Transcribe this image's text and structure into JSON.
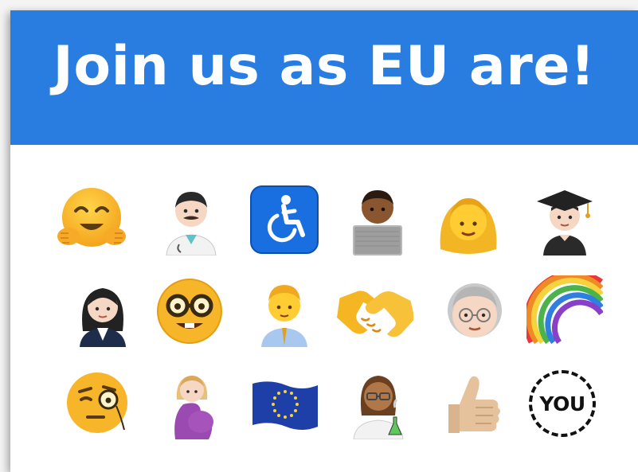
{
  "banner": {
    "title": "Join us as EU are!",
    "background": "#2a7de0",
    "text_color": "#ffffff"
  },
  "emoji_grid": {
    "rows": [
      [
        "hugging-face",
        "male-health-worker",
        "wheelchair-symbol",
        "man-technologist",
        "blond-woman",
        "male-graduate"
      ],
      [
        "woman-office-worker",
        "nerd-face",
        "man-office-worker",
        "handshake",
        "older-person",
        "rainbow"
      ],
      [
        "face-with-monocle",
        "pregnant-woman",
        "eu-flag",
        "woman-scientist",
        "thumbs-up",
        "you-badge"
      ]
    ]
  },
  "you_badge": {
    "label": "YOU"
  }
}
